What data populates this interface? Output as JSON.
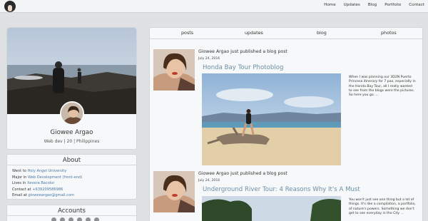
{
  "nav": {
    "items": [
      "Home",
      "Updates",
      "Blog",
      "Portfolio",
      "Contact"
    ]
  },
  "profile": {
    "name": "Giowee Argao",
    "subtitle": "Web dev | 20 | Philippines"
  },
  "about": {
    "title": "About",
    "lines": [
      {
        "label": "Went to ",
        "value": "Holy Angel University"
      },
      {
        "label": "Major in ",
        "value": "Web Development (front-end)"
      },
      {
        "label": "Lives in ",
        "value": "Xevera Bacolor"
      },
      {
        "label": "Contact at ",
        "value": "+639209586986"
      },
      {
        "label": "Email at ",
        "value": "gioweeargao@gmail.com"
      }
    ]
  },
  "accounts": {
    "title": "Accounts",
    "icons": [
      "twitter-icon",
      "instagram-icon",
      "facebook-icon",
      "github-icon",
      "codepen-icon",
      "linkedin-icon"
    ]
  },
  "tabs": [
    "posts",
    "updates",
    "blog",
    "photos"
  ],
  "posts": [
    {
      "header": "Giowee Argao just published a blog post",
      "date": "July 24, 2016",
      "title": "Honda Bay Tour Photoblog",
      "excerpt": "When I was planning our 3D2N Puerto Princesa itinerary for 7 pax, especially in the Honda Bay Tour, all I really wanted to see from the blogs were the pictures. So here you go. ..."
    },
    {
      "header": "Giowee Argao just published a blog post",
      "date": "July 24, 2016",
      "title": "Underground River Tour: 4 Reasons Why It's A Must",
      "excerpt": "You won't just see one thing but a lot of things. It's like a compilation, a portfolio, of nature's powers. Something we don't get to see everyday in the City ..."
    }
  ],
  "colors": {
    "link": "#4a7aa8",
    "title": "#6b8fa8",
    "background": "#dfe1e3",
    "card": "#f7f8f9"
  }
}
